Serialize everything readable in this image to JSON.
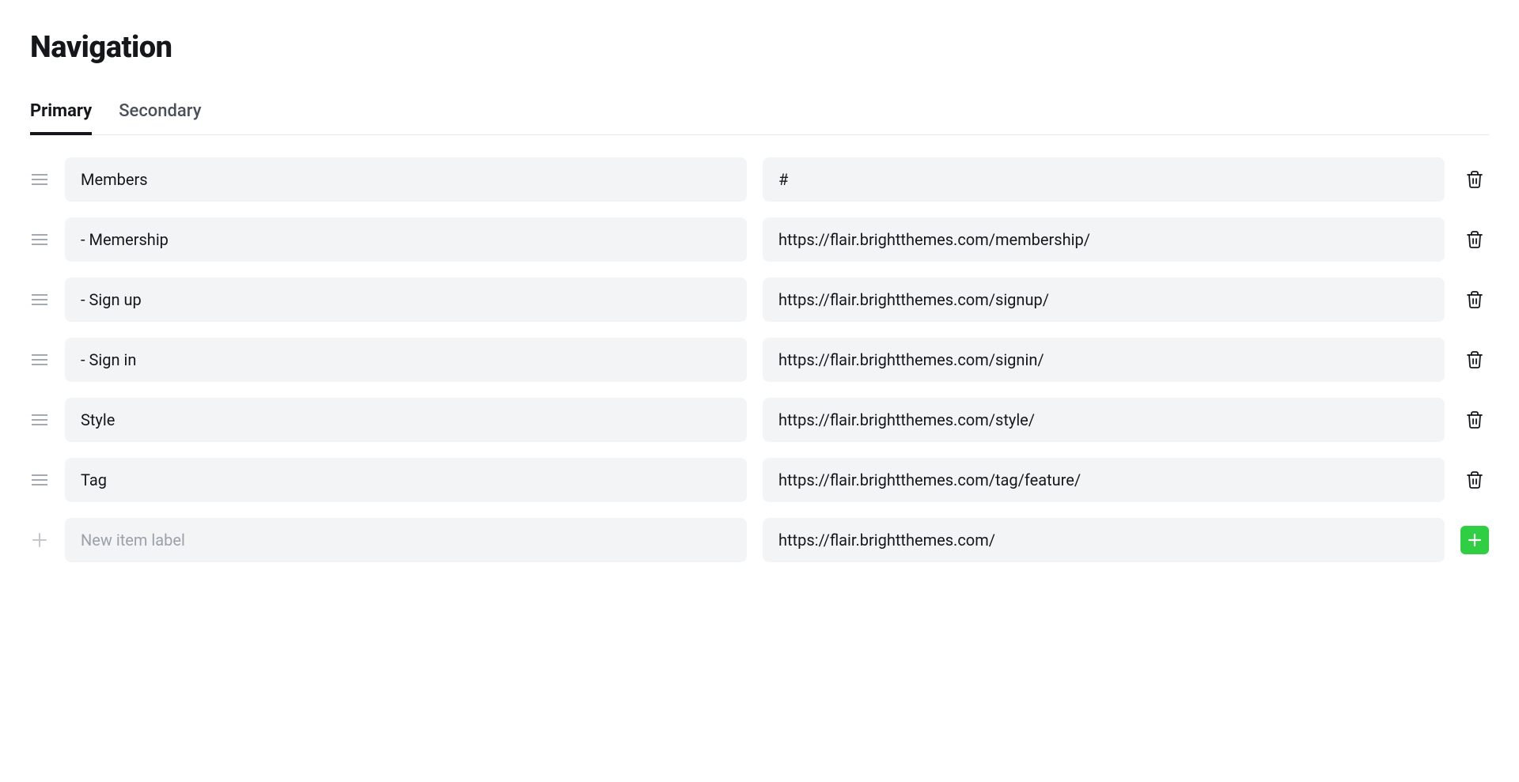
{
  "title": "Navigation",
  "tabs": [
    {
      "label": "Primary",
      "active": true
    },
    {
      "label": "Secondary",
      "active": false
    }
  ],
  "rows": [
    {
      "label": "Members",
      "url": "#"
    },
    {
      "label": "- Memership",
      "url": "https://flair.brightthemes.com/membership/"
    },
    {
      "label": "- Sign up",
      "url": "https://flair.brightthemes.com/signup/"
    },
    {
      "label": "- Sign in",
      "url": "https://flair.brightthemes.com/signin/"
    },
    {
      "label": "Style",
      "url": "https://flair.brightthemes.com/style/"
    },
    {
      "label": "Tag",
      "url": "https://flair.brightthemes.com/tag/feature/"
    }
  ],
  "new_row": {
    "label_placeholder": "New item label",
    "url_value": "https://flair.brightthemes.com/"
  }
}
